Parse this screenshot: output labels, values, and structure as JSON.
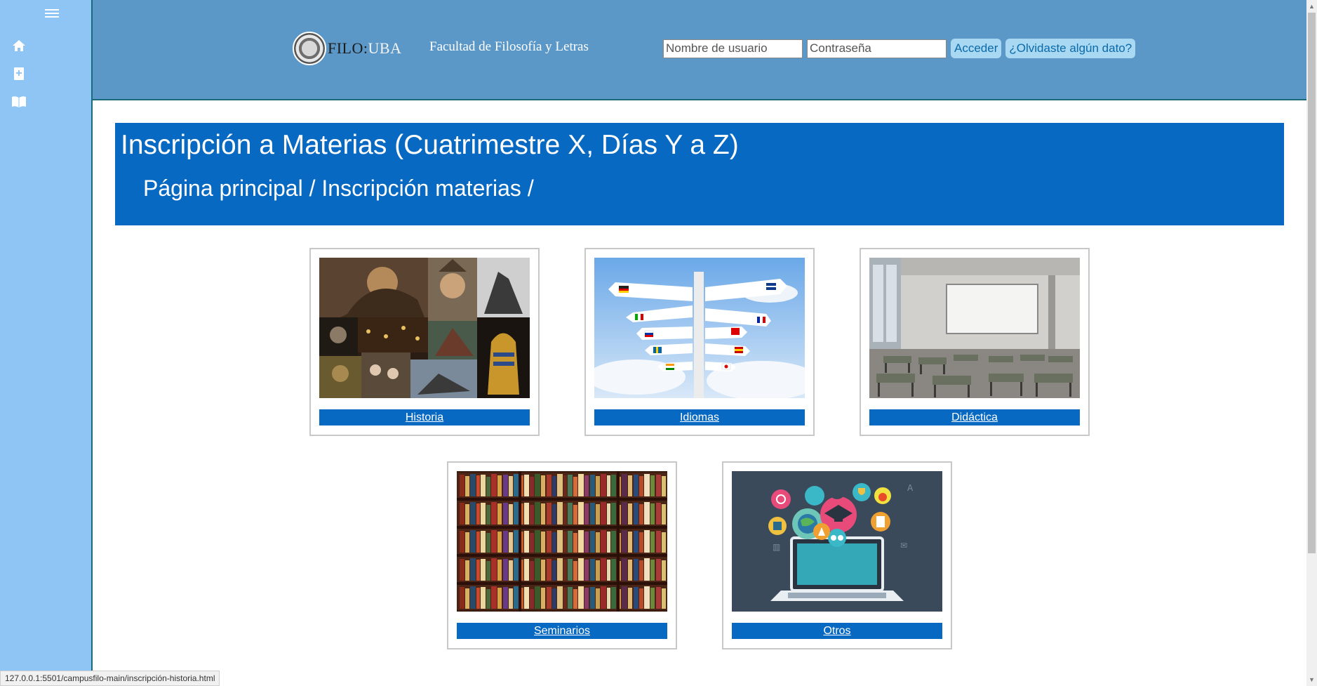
{
  "sidebar": {
    "menu_icon": "hamburger-icon",
    "items": [
      {
        "icon": "home-icon"
      },
      {
        "icon": "plus-book-icon"
      },
      {
        "icon": "open-book-icon"
      }
    ]
  },
  "header": {
    "logo_filo": "FILO",
    "logo_colon": ":",
    "logo_uba": "UBA",
    "faculty": "Facultad de Filosofía y Letras",
    "username_placeholder": "Nombre de usuario",
    "password_placeholder": "Contraseña",
    "login_label": "Acceder",
    "forgot_label": "¿Olvidaste algún dato?"
  },
  "main": {
    "title": "Inscripción a Materias (Cuatrimestre X, Días Y a Z)",
    "breadcrumb": {
      "home": "Página principal",
      "sep1": " / ",
      "current": "Inscripción materias",
      "sep2": " /"
    },
    "cards": [
      {
        "label": "Historia",
        "image": "history-collage"
      },
      {
        "label": "Idiomas",
        "image": "languages-signpost"
      },
      {
        "label": "Didáctica",
        "image": "empty-classroom"
      },
      {
        "label": "Seminarios",
        "image": "bookshelf"
      },
      {
        "label": "Otros",
        "image": "education-laptop-illustration"
      }
    ]
  },
  "status_bar": {
    "url": "127.0.0.1:5501/campusfilo-main/inscripción-historia.html"
  },
  "colors": {
    "sidebar": "#8ec5f5",
    "header": "#5b98c8",
    "banner": "#0769c2",
    "button_bg": "#a9d8f3"
  }
}
